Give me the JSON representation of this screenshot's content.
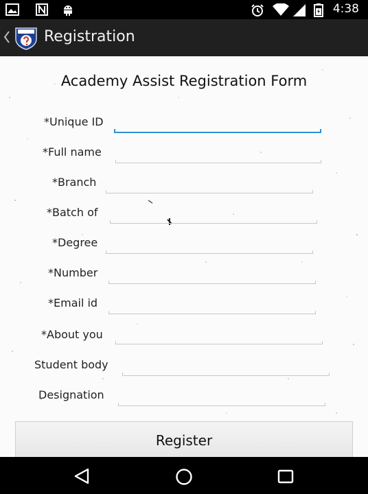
{
  "status_bar": {
    "time": "4:38",
    "left_icons": [
      "image-icon",
      "notification-n-icon",
      "android-icon"
    ],
    "right_icons": [
      "alarm-icon",
      "wifi-icon",
      "signal-icon",
      "battery-icon"
    ]
  },
  "action_bar": {
    "title": "Registration",
    "logo_icon": "academy-assist-badge-icon"
  },
  "form": {
    "title": "Academy Assist Registration Form",
    "fields": [
      {
        "label": "*Unique ID",
        "value": ""
      },
      {
        "label": "*Full name",
        "value": ""
      },
      {
        "label": "*Branch",
        "value": ""
      },
      {
        "label": "*Batch of",
        "value": ""
      },
      {
        "label": "*Degree",
        "value": ""
      },
      {
        "label": "*Number",
        "value": ""
      },
      {
        "label": "*Email id",
        "value": ""
      },
      {
        "label": "*About you",
        "value": ""
      },
      {
        "label": "Student body",
        "value": ""
      },
      {
        "label": "Designation",
        "value": ""
      }
    ],
    "register_label": "Register",
    "accent_color": "#2d8fd6"
  },
  "nav_bar": {
    "icons": [
      "back-triangle-icon",
      "home-circle-icon",
      "recents-square-icon"
    ]
  }
}
